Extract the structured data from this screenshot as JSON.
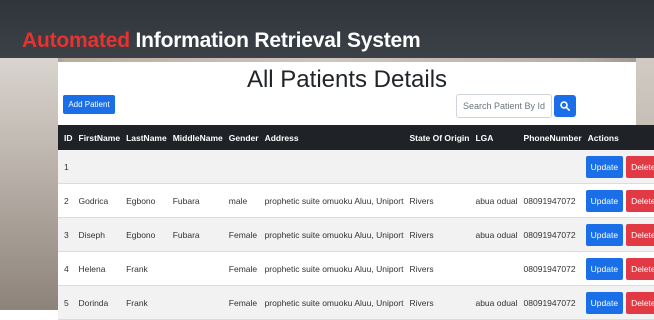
{
  "header": {
    "title_accent": "Automated",
    "title_rest": " Information Retrieval System",
    "accent_color": "#e8322f"
  },
  "page": {
    "title": "All Patients Details",
    "add_button_label": "Add Patient",
    "search_placeholder": "Search Patient By Id",
    "search_icon": "search-icon"
  },
  "table": {
    "columns": [
      "ID",
      "FirstName",
      "LastName",
      "MiddleName",
      "Gender",
      "Address",
      "State Of Origin",
      "LGA",
      "PhoneNumber",
      "Actions"
    ],
    "update_label": "Update",
    "delete_label": "Delete",
    "rows": [
      {
        "id": "1",
        "first": "",
        "last": "",
        "middle": "",
        "gender": "",
        "address": "",
        "state": "",
        "lga": "",
        "phone": ""
      },
      {
        "id": "2",
        "first": "Godrica",
        "last": "Egbono",
        "middle": "Fubara",
        "gender": "male",
        "address": "prophetic suite omuoku Aluu, Uniport",
        "state": "Rivers",
        "lga": "abua odual",
        "phone": "08091947072"
      },
      {
        "id": "3",
        "first": "Diseph",
        "last": "Egbono",
        "middle": "Fubara",
        "gender": "Female",
        "address": "prophetic suite omuoku Aluu, Uniport",
        "state": "Rivers",
        "lga": "abua odual",
        "phone": "08091947072"
      },
      {
        "id": "4",
        "first": "Helena",
        "last": "Frank",
        "middle": "",
        "gender": "Female",
        "address": "prophetic suite omuoku Aluu, Uniport",
        "state": "Rivers",
        "lga": "",
        "phone": "08091947072"
      },
      {
        "id": "5",
        "first": "Dorinda",
        "last": "Frank",
        "middle": "",
        "gender": "Female",
        "address": "prophetic suite omuoku Aluu, Uniport",
        "state": "Rivers",
        "lga": "abua odual",
        "phone": "08091947072"
      }
    ]
  },
  "colors": {
    "header_bg": "#34393e",
    "primary": "#1a6fe8",
    "danger": "#e23a44",
    "table_head_bg": "#1f2226"
  }
}
